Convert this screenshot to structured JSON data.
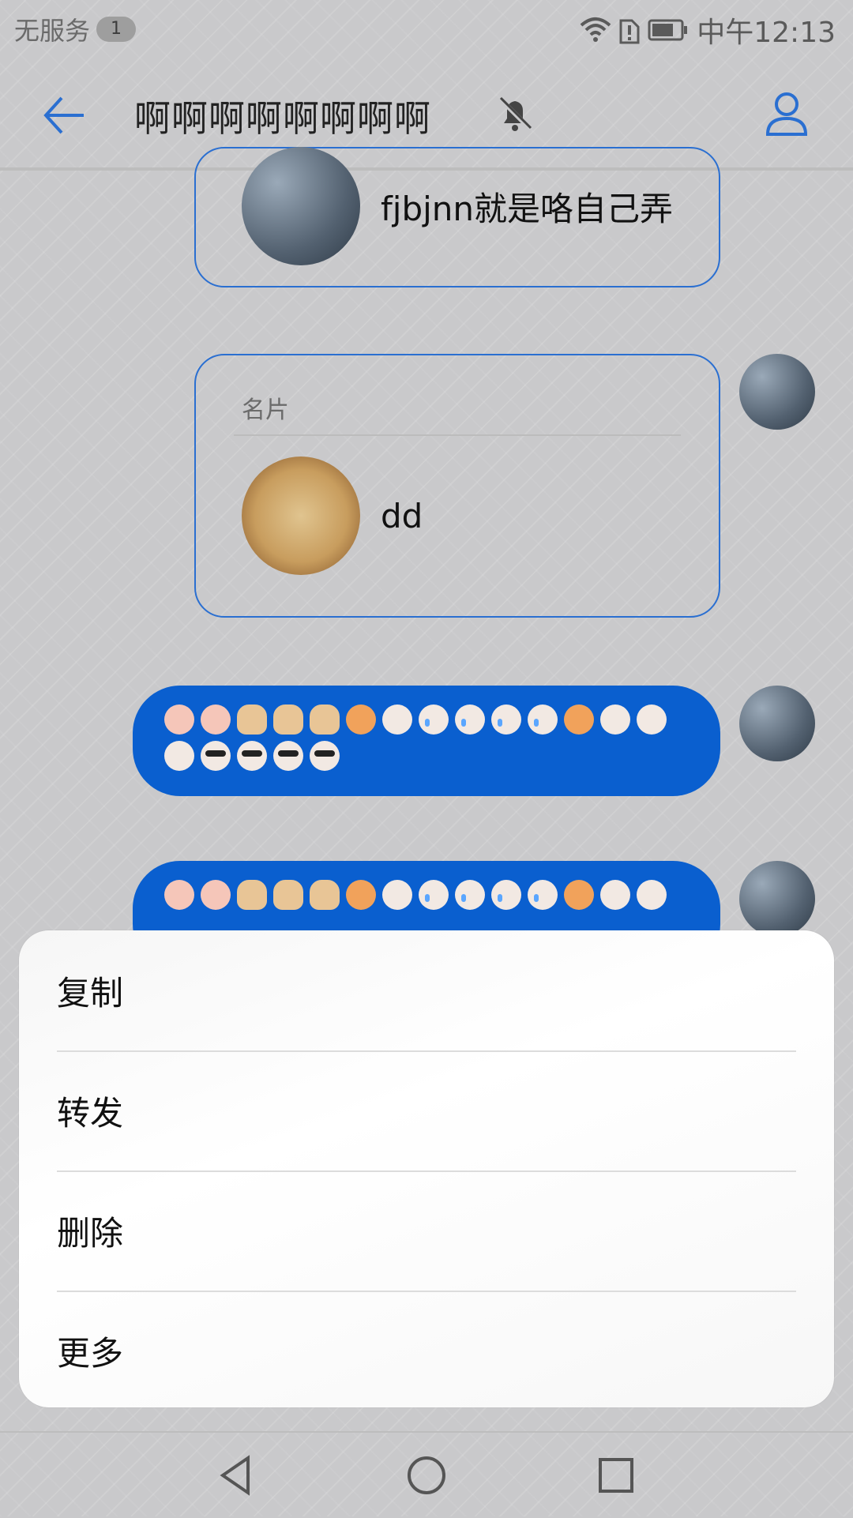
{
  "status_bar": {
    "carrier": "无服务",
    "sim_badge": "1",
    "time": "中午12:13"
  },
  "header": {
    "title": "啊啊啊啊啊啊啊啊",
    "icons": [
      "back-arrow-icon",
      "mute-bell-icon",
      "contact-icon"
    ]
  },
  "chat": {
    "card_top": {
      "name": "fjbjnn就是咯自己弄"
    },
    "card_middle": {
      "title": "名片",
      "name": "dd"
    },
    "emoji_messages": [
      {
        "emoji_sequence": [
          "pig",
          "pig",
          "victory-hand",
          "rock-hand",
          "point-hand",
          "popcorn",
          "smirk",
          "cry",
          "cry",
          "cry",
          "cry",
          "fire",
          "surprised",
          "surprised",
          "surprised",
          "cool",
          "cool",
          "cool",
          "cool"
        ]
      },
      {
        "emoji_sequence": [
          "pig",
          "pig",
          "victory-hand",
          "rock-hand",
          "point-hand",
          "popcorn",
          "smirk",
          "cry",
          "cry",
          "cry",
          "cry",
          "fire",
          "surprised",
          "surprised"
        ]
      }
    ]
  },
  "context_menu": {
    "items": [
      {
        "label": "复制"
      },
      {
        "label": "转发"
      },
      {
        "label": "删除"
      },
      {
        "label": "更多"
      }
    ]
  },
  "nav": {
    "icons": [
      "back-triangle-icon",
      "home-circle-icon",
      "recent-square-icon"
    ]
  },
  "colors": {
    "accent_blue": "#0a5fcf",
    "card_border": "#2a6fd1",
    "background": "#c9c9cb"
  }
}
